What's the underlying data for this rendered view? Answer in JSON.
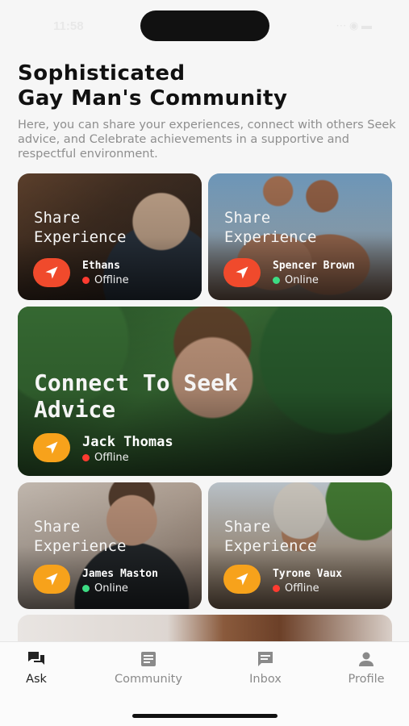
{
  "status_bar": {
    "time": "11:58",
    "indicators": "⋯ ◉ ▬"
  },
  "header": {
    "title": "Sophisticated\nGay Man's Community",
    "subtitle": "Here, you can share your experiences, connect with others Seek advice, and Celebrate achievements in a supportive and respectful environment."
  },
  "cards": [
    {
      "label": "Share\nExperience",
      "name": "Ethans",
      "status": "Offline",
      "status_color": "#ff3b30",
      "button_color": "#f04a2c"
    },
    {
      "label": "Share\nExperience",
      "name": "Spencer Brown",
      "status": "Online",
      "status_color": "#3ddc84",
      "button_color": "#f04a2c"
    },
    {
      "label": "Connect To Seek\nAdvice",
      "name": "Jack Thomas",
      "status": "Offline",
      "status_color": "#ff3b30",
      "button_color": "#f7a21b"
    },
    {
      "label": "Share\nExperience",
      "name": "James Maston",
      "status": "Online",
      "status_color": "#3ddc84",
      "button_color": "#f7a21b"
    },
    {
      "label": "Share\nExperience",
      "name": "Tyrone Vaux",
      "status": "Offline",
      "status_color": "#ff3b30",
      "button_color": "#f7a21b"
    }
  ],
  "tabs": [
    {
      "label": "Ask",
      "icon": "chat-bubbles-icon",
      "active": true
    },
    {
      "label": "Community",
      "icon": "document-icon",
      "active": false
    },
    {
      "label": "Inbox",
      "icon": "message-icon",
      "active": false
    },
    {
      "label": "Profile",
      "icon": "person-icon",
      "active": false
    }
  ]
}
